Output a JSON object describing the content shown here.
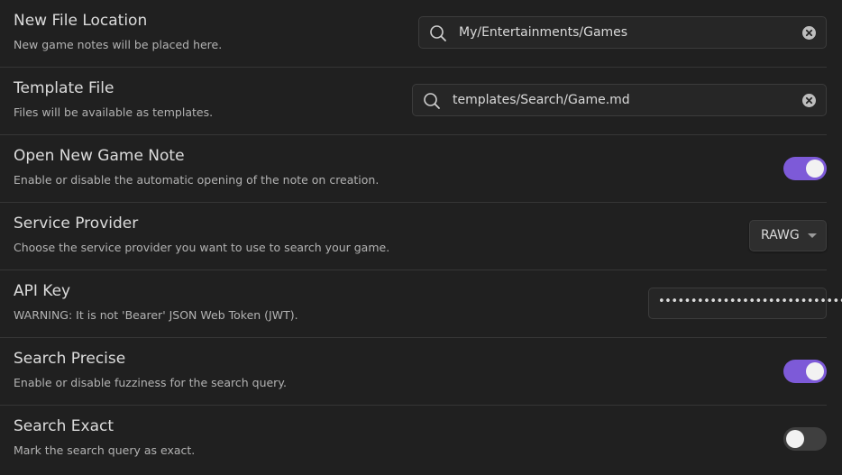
{
  "settings": {
    "new_file_location": {
      "title": "New File Location",
      "description": "New game notes will be placed here.",
      "value": "My/Entertainments/Games",
      "icon": "search-icon"
    },
    "template_file": {
      "title": "Template File",
      "description": "Files will be available as templates.",
      "value": "templates/Search/Game.md",
      "icon": "search-icon"
    },
    "open_new_game_note": {
      "title": "Open New Game Note",
      "description": "Enable or disable the automatic opening of the note on creation.",
      "enabled": true
    },
    "service_provider": {
      "title": "Service Provider",
      "description": "Choose the service provider you want to use to search your game.",
      "selected": "RAWG"
    },
    "api_key": {
      "title": "API Key",
      "description": "WARNING: It is not 'Bearer' JSON Web Token (JWT).",
      "masked_value": "••••••••••••••••••••••••••••••••"
    },
    "search_precise": {
      "title": "Search Precise",
      "description": "Enable or disable fuzziness for the search query.",
      "enabled": true
    },
    "search_exact": {
      "title": "Search Exact",
      "description": "Mark the search query as exact.",
      "enabled": false
    }
  },
  "colors": {
    "background": "#202020",
    "accent": "#7d5ad8",
    "toggle_off": "#3f3f3f",
    "text": "#dcdcdc",
    "muted_text": "#b3b3b3"
  }
}
